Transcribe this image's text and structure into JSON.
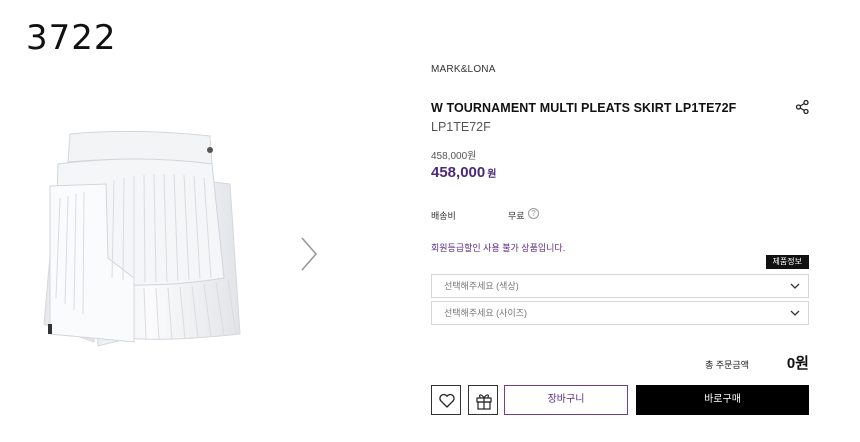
{
  "page_number": "3722",
  "product": {
    "brand": "MARK&LONA",
    "title": "W TOURNAMENT MULTI PLEATS SKIRT LP1TE72F",
    "code": "LP1TE72F",
    "original_price": "458,000원",
    "sale_price": "458,000",
    "currency_unit": "원"
  },
  "shipping": {
    "label": "배송비",
    "value": "무료",
    "help_icon": "?"
  },
  "member_note": "회원등급할인 사용 불가 상품입니다.",
  "info_badge": "제품정보",
  "options": {
    "color_placeholder": "선택해주세요 (색상)",
    "size_placeholder": "선택해주세요 (사이즈)"
  },
  "total": {
    "label": "총 주문금액",
    "value": "0원"
  },
  "buttons": {
    "cart": "장바구니",
    "buy": "바로구매"
  },
  "colors": {
    "accent_purple": "#4b2a7a",
    "buy_button": "#000000"
  },
  "icons": [
    "share-icon",
    "help-icon",
    "chevron-down-icon",
    "heart-icon",
    "gift-icon",
    "chevron-right-icon"
  ]
}
